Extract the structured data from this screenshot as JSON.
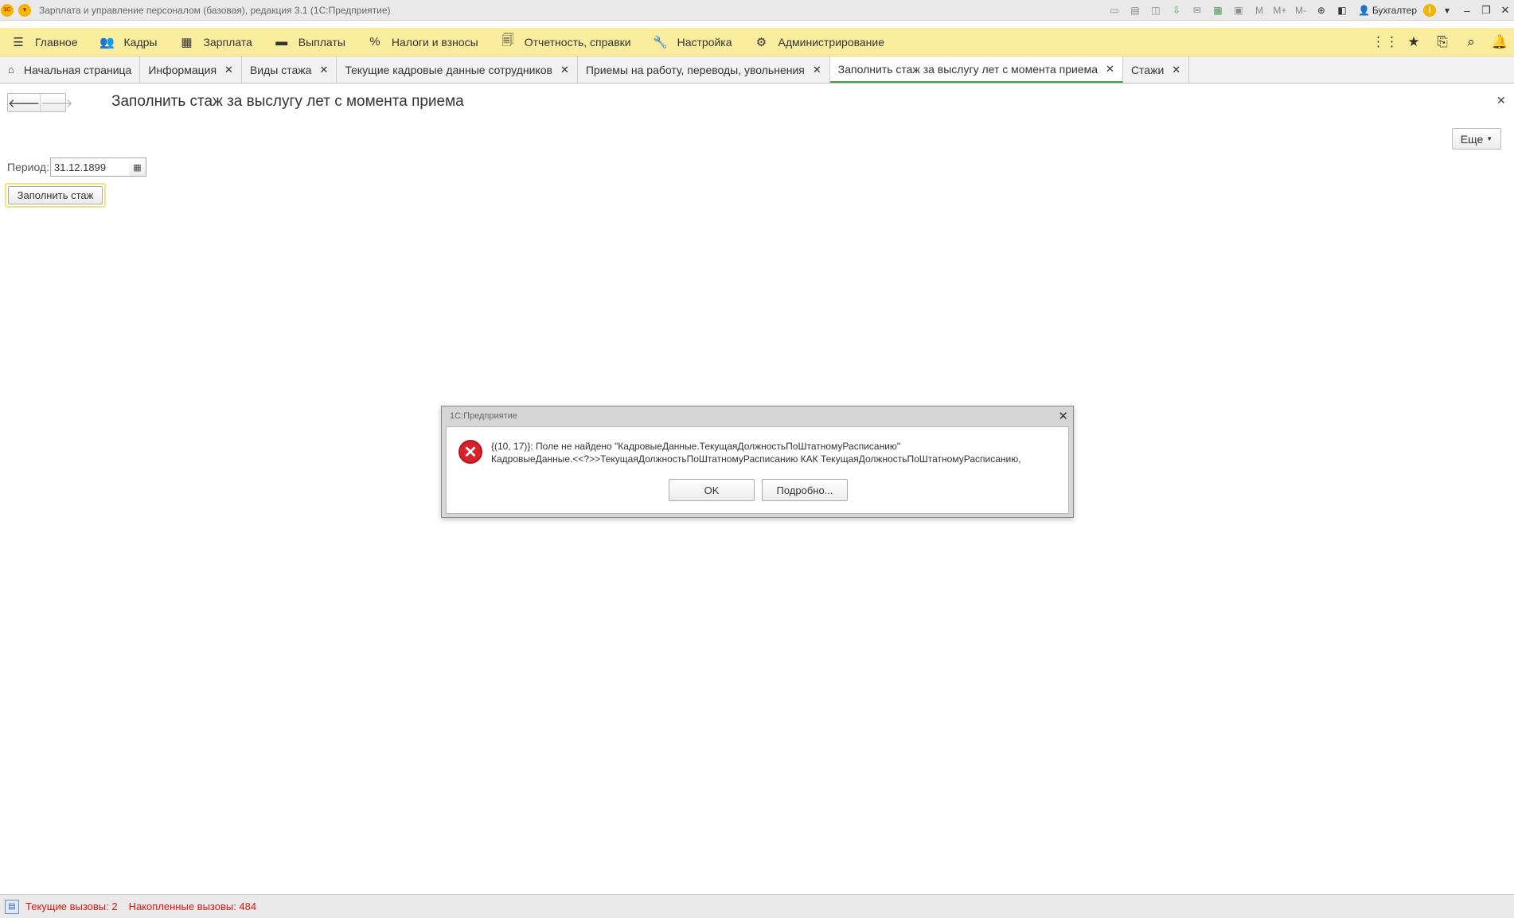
{
  "window": {
    "title": "Зарплата и управление персоналом (базовая), редакция 3.1  (1С:Предприятие)",
    "user": "Бухгалтер",
    "logo_text": "1С"
  },
  "sections": [
    {
      "label": "Главное",
      "icon": "hamburger-icon",
      "glyph": "☰"
    },
    {
      "label": "Кадры",
      "icon": "people-icon",
      "glyph": "👥"
    },
    {
      "label": "Зарплата",
      "icon": "calculator-icon",
      "glyph": "▦"
    },
    {
      "label": "Выплаты",
      "icon": "wallet-icon",
      "glyph": "▬"
    },
    {
      "label": "Налоги и взносы",
      "icon": "percent-icon",
      "glyph": "%"
    },
    {
      "label": "Отчетность, справки",
      "icon": "documents-icon",
      "glyph": "🗐"
    },
    {
      "label": "Настройка",
      "icon": "wrench-icon",
      "glyph": "🔧"
    },
    {
      "label": "Администрирование",
      "icon": "gear-icon",
      "glyph": "⚙"
    }
  ],
  "open_tabs": [
    {
      "label": "Начальная страница",
      "closable": false,
      "active": false
    },
    {
      "label": "Информация",
      "closable": true,
      "active": false
    },
    {
      "label": "Виды стажа",
      "closable": true,
      "active": false
    },
    {
      "label": "Текущие кадровые данные сотрудников",
      "closable": true,
      "active": false
    },
    {
      "label": "Приемы на работу, переводы, увольнения",
      "closable": true,
      "active": false
    },
    {
      "label": "Заполнить стаж за выслугу лет с момента приема",
      "closable": true,
      "active": true
    },
    {
      "label": "Стажи",
      "closable": true,
      "active": false
    }
  ],
  "form": {
    "title": "Заполнить стаж за выслугу лет с момента приема",
    "more_label": "Еще",
    "period_label": "Период:",
    "period_value": "31.12.1899",
    "fill_button": "Заполнить стаж"
  },
  "dialog": {
    "title": "1С:Предприятие",
    "message_line1": "{(10, 17)}: Поле не найдено \"КадровыеДанные.ТекущаяДолжностьПоШтатномуРасписанию\"",
    "message_line2": "КадровыеДанные.<<?>>ТекущаяДолжностьПоШтатномуРасписанию КАК ТекущаяДолжностьПоШтатномуРасписанию,",
    "ok_label": "OK",
    "details_label": "Подробно..."
  },
  "status": {
    "current_calls": "Текущие вызовы: 2",
    "accumulated_calls": "Накопленные вызовы: 484"
  },
  "colors": {
    "sections_bg": "#fbed9e",
    "active_tab_underline": "#4c9b4c",
    "error_red": "#d9212b",
    "status_text": "#e01010"
  }
}
